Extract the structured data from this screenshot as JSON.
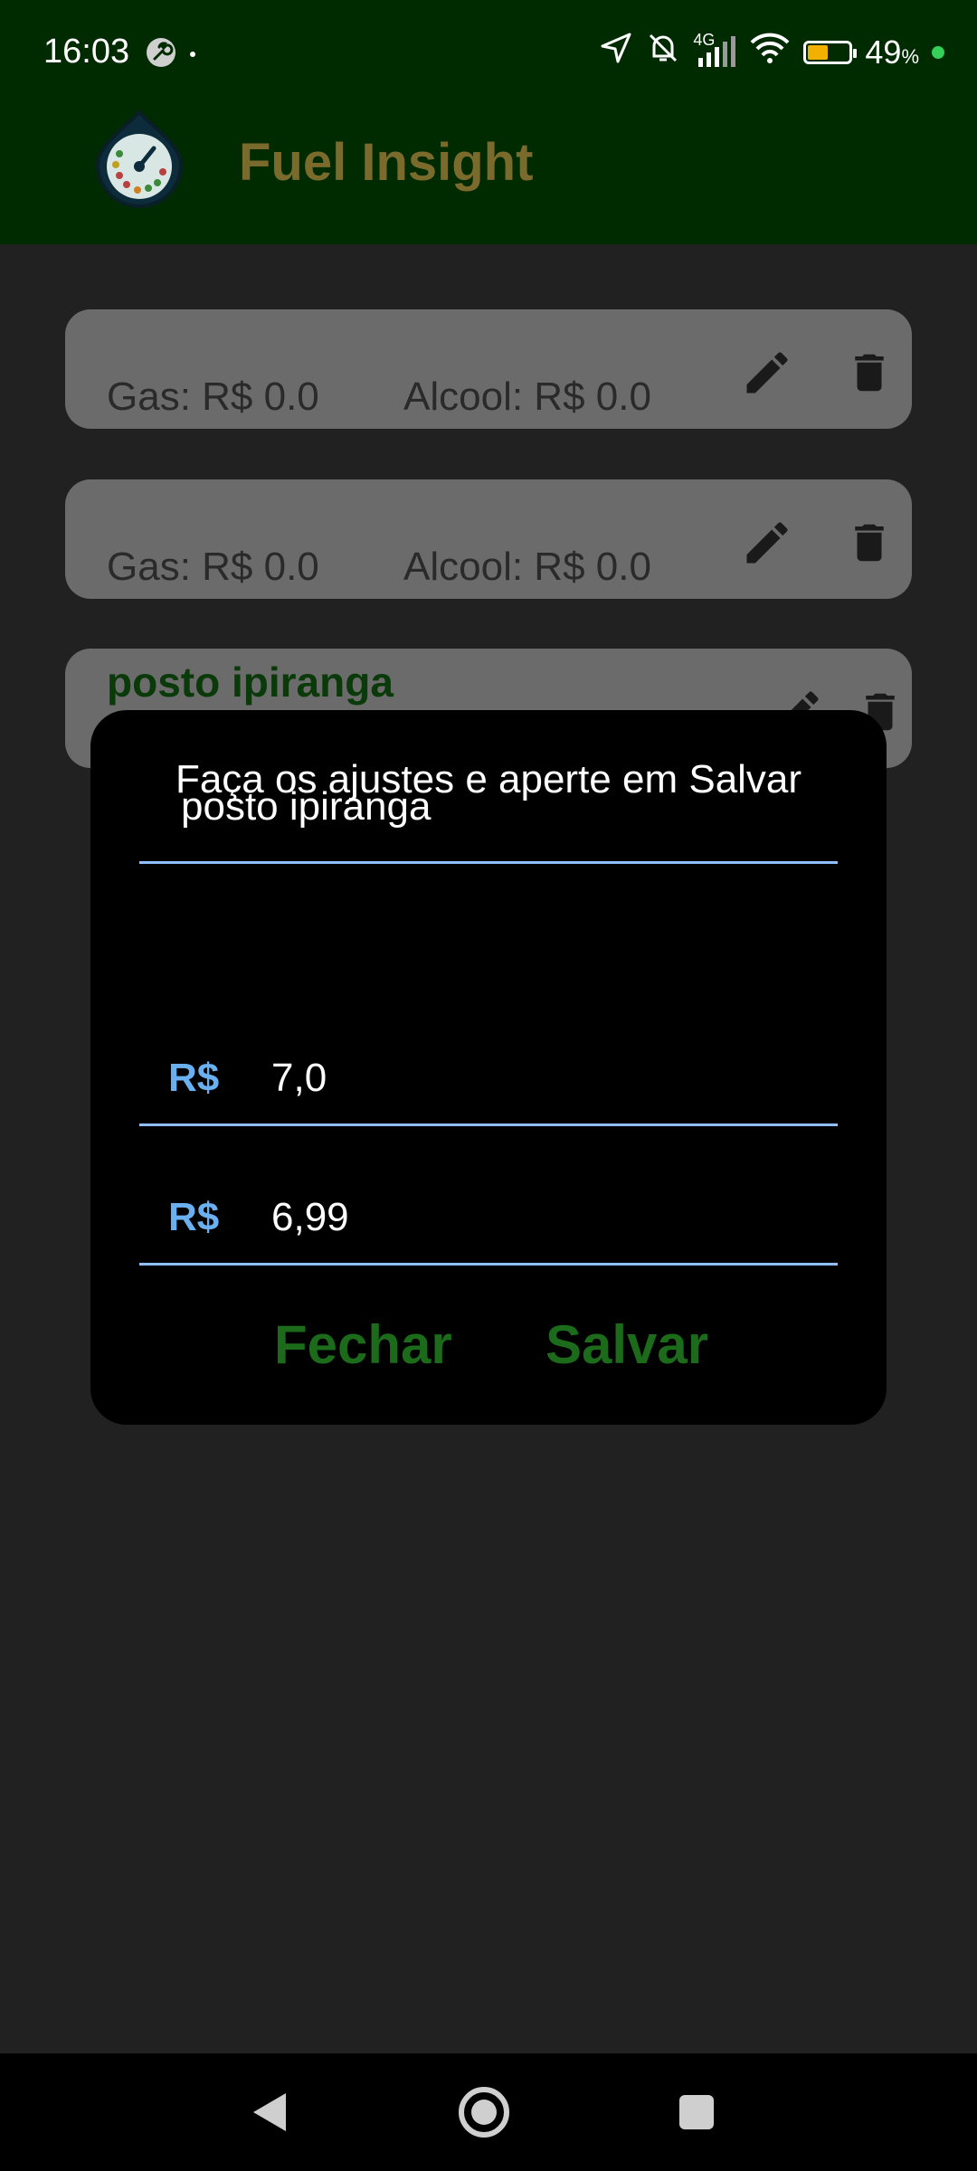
{
  "status_bar": {
    "time": "16:03",
    "network": "4G",
    "battery_percent": "49",
    "battery_unit": "%",
    "battery_level": 0.49
  },
  "app": {
    "title": "Fuel Insight"
  },
  "stations": [
    {
      "name": "",
      "gas": "Gas: R$ 0.0",
      "alcool": "Alcool: R$ 0.0"
    },
    {
      "name": "",
      "gas": "Gas: R$ 0.0",
      "alcool": "Alcool: R$ 0.0"
    },
    {
      "name": "posto ipiranga",
      "gas": "",
      "alcool": ""
    }
  ],
  "dialog": {
    "title": "Faça os ajustes e aperte em Salvar",
    "name_value": "posto ipiranga",
    "currency_prefix": "R$",
    "gas_value": "7,0",
    "alcool_value": "6,99",
    "close_label": "Fechar",
    "save_label": "Salvar"
  },
  "colors": {
    "app_bar": "#002a00",
    "accent_green": "#1b6b1b",
    "field_underline": "#8fbfff",
    "prefix_blue": "#6ab0f0"
  },
  "icons": [
    "wrench-icon",
    "location-arrow-icon",
    "bell-off-icon",
    "signal-icon",
    "wifi-icon",
    "battery-icon",
    "edit-icon",
    "delete-icon",
    "back-icon",
    "home-icon",
    "recent-apps-icon"
  ]
}
